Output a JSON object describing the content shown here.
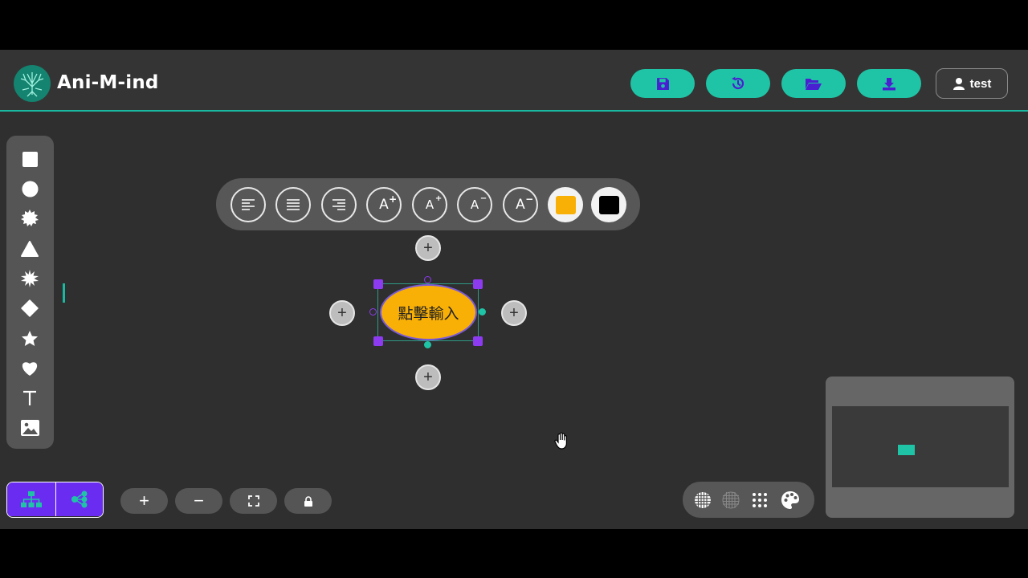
{
  "header": {
    "app_title": "Ani-M-ind",
    "logo_icon": "tree-logo-icon",
    "accent_color": "#1fc4a6",
    "buttons": [
      {
        "name": "save",
        "icon": "floppy-disk-icon"
      },
      {
        "name": "history",
        "icon": "history-clock-icon"
      },
      {
        "name": "open",
        "icon": "folder-open-icon"
      },
      {
        "name": "download",
        "icon": "download-icon"
      }
    ],
    "user": {
      "label": "test",
      "icon": "user-icon"
    }
  },
  "shape_toolbar": {
    "items": [
      "square",
      "circle",
      "burst",
      "triangle",
      "star-burst",
      "diamond",
      "star",
      "heart",
      "text",
      "image"
    ]
  },
  "format_toolbar": {
    "items": [
      "align-left",
      "align-center",
      "align-right",
      "font-size-increase-large",
      "font-size-increase-small",
      "font-size-decrease-small",
      "font-size-decrease-large"
    ],
    "fill_color": "#f9b006",
    "text_color": "#000000"
  },
  "canvas": {
    "node": {
      "text": "點擊輸入",
      "fill": "#f9b006"
    },
    "add_buttons": [
      "add-top",
      "add-left",
      "add-right",
      "add-bottom"
    ]
  },
  "bottom_controls": {
    "layout_modes": [
      "tree-layout",
      "mindmap-layout"
    ],
    "zoom": {
      "zoom_in": "+",
      "zoom_out": "−"
    },
    "grid_options": [
      "grid-dense",
      "grid-lines",
      "grid-dots",
      "palette"
    ]
  }
}
